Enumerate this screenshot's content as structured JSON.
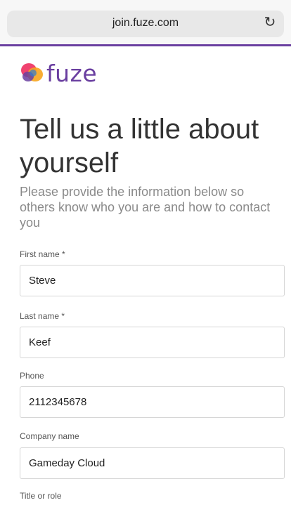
{
  "browser": {
    "url": "join.fuze.com",
    "reload_icon": "reload-icon"
  },
  "logo": {
    "text": "fuze",
    "mark_colors": [
      "#f0426f",
      "#f7a51d",
      "#6a3fa0",
      "#2e7fd0"
    ]
  },
  "page": {
    "title": "Tell us a little about yourself",
    "subtitle": "Please provide the information below so others know who you are and how to contact you"
  },
  "form": {
    "first_name": {
      "label": "First name *",
      "value": "Steve"
    },
    "last_name": {
      "label": "Last name *",
      "value": "Keef"
    },
    "phone": {
      "label": "Phone",
      "value": "2112345678"
    },
    "company": {
      "label": "Company name",
      "value": "Gameday Cloud"
    },
    "title_role": {
      "label": "Title or role"
    }
  },
  "colors": {
    "accent": "#6a3fa0",
    "input_border": "#d5d5d5",
    "subtitle": "#8a8a8a"
  }
}
